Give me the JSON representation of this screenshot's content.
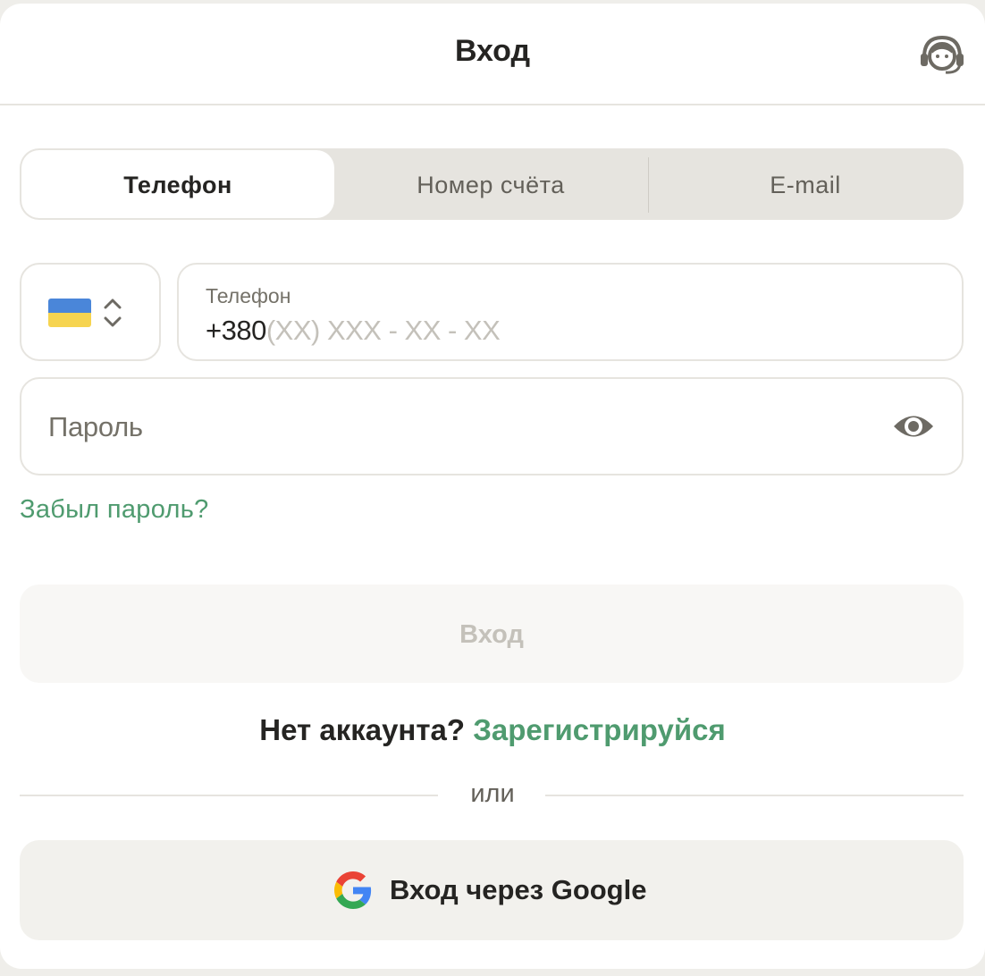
{
  "header": {
    "title": "Вход",
    "support_icon": "headset-support-icon"
  },
  "tabs": [
    {
      "label": "Телефон",
      "active": true
    },
    {
      "label": "Номер счёта",
      "active": false
    },
    {
      "label": "E-mail",
      "active": false
    }
  ],
  "country_select": {
    "flag": "ukraine-flag-icon",
    "selector_icon": "chevron-up-down-icon"
  },
  "phone": {
    "label": "Телефон",
    "prefix": "+380",
    "mask": "(XX) XXX - XX - XX"
  },
  "password": {
    "placeholder": "Пароль",
    "toggle_icon": "eye-icon"
  },
  "forgot_password": "Забыл пароль?",
  "login_button": "Вход",
  "signup": {
    "text": "Нет аккаунта?",
    "link": "Зарегистрируйся"
  },
  "divider_text": "или",
  "google_button": {
    "label": "Вход через Google",
    "icon": "google-icon"
  },
  "colors": {
    "accent_green": "#4f9b6f",
    "text_primary": "#252422",
    "text_secondary": "#747168",
    "border": "#e6e4df",
    "disabled_text": "#c4c1ba"
  }
}
